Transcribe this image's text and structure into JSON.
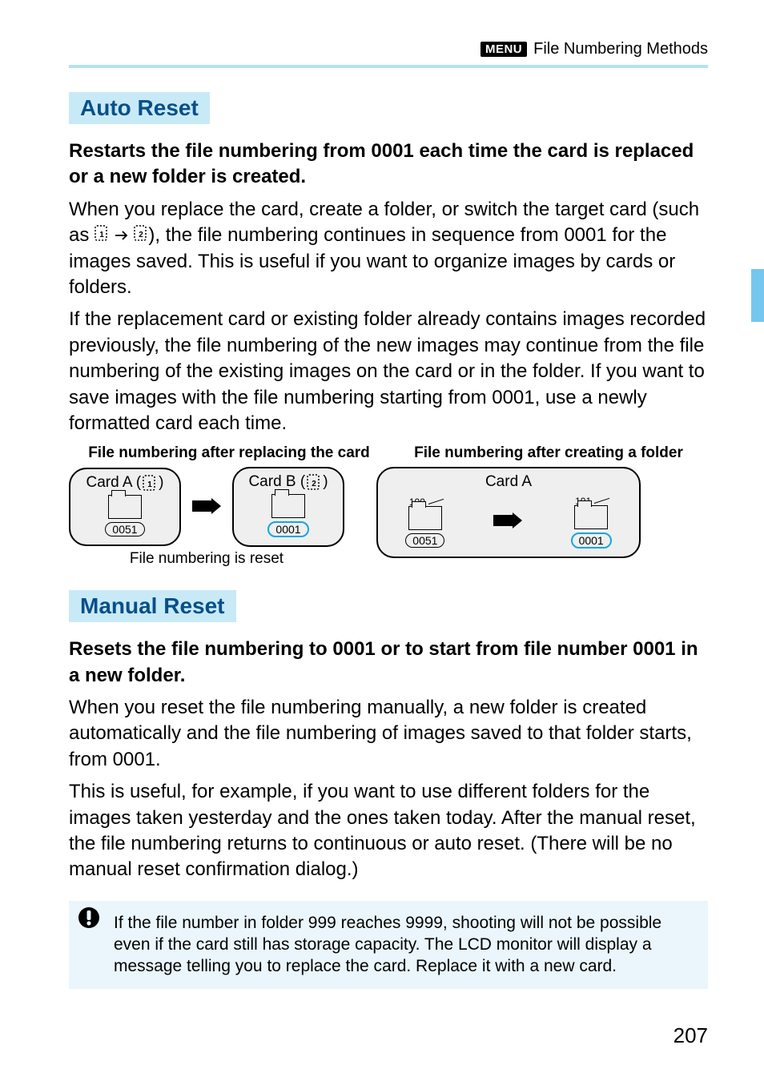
{
  "header": {
    "menu_label": "MENU",
    "title": "File Numbering Methods"
  },
  "section_auto": {
    "heading": "Auto Reset",
    "intro": "Restarts the file numbering from 0001 each time the card is replaced or a new folder is created.",
    "para1_a": "When you replace the card, create a folder, or switch the target card (such as ",
    "para1_b": "), the file numbering continues in sequence from 0001 for the images saved. This is useful if you want to organize images by cards or folders.",
    "para2": "If the replacement card or existing folder already contains images recorded previously, the file numbering of the new images may continue from the file numbering of the existing images on the card or in the folder. If you want to save images with the file numbering starting from 0001, use a newly formatted card each time.",
    "diag_title_left": "File numbering after replacing the card",
    "diag_title_right": "File numbering after creating a folder",
    "cardA_label": "Card A (",
    "cardA_close": ")",
    "cardB_label": "Card B (",
    "cardB_close": ")",
    "cardA2_label": "Card A",
    "num_0051": "0051",
    "num_0001": "0001",
    "folder_100": "100",
    "folder_101": "101",
    "reset_caption": "File numbering is reset"
  },
  "section_manual": {
    "heading": "Manual Reset",
    "intro": "Resets the file numbering to 0001 or to start from file number 0001 in a new folder.",
    "para1": "When you reset the file numbering manually, a new folder is created automatically and the file numbering of images saved to that folder starts, from 0001.",
    "para2": "This is useful, for example, if you want to use different folders for the images taken yesterday and the ones taken today. After the manual reset, the file numbering returns to continuous or auto reset. (There will be no manual reset confirmation dialog.)"
  },
  "note": {
    "text": "If the file number in folder 999 reaches 9999, shooting will not be possible even if the card still has storage capacity. The LCD monitor will display a message telling you to replace the card. Replace it with a new card."
  },
  "page_number": "207"
}
